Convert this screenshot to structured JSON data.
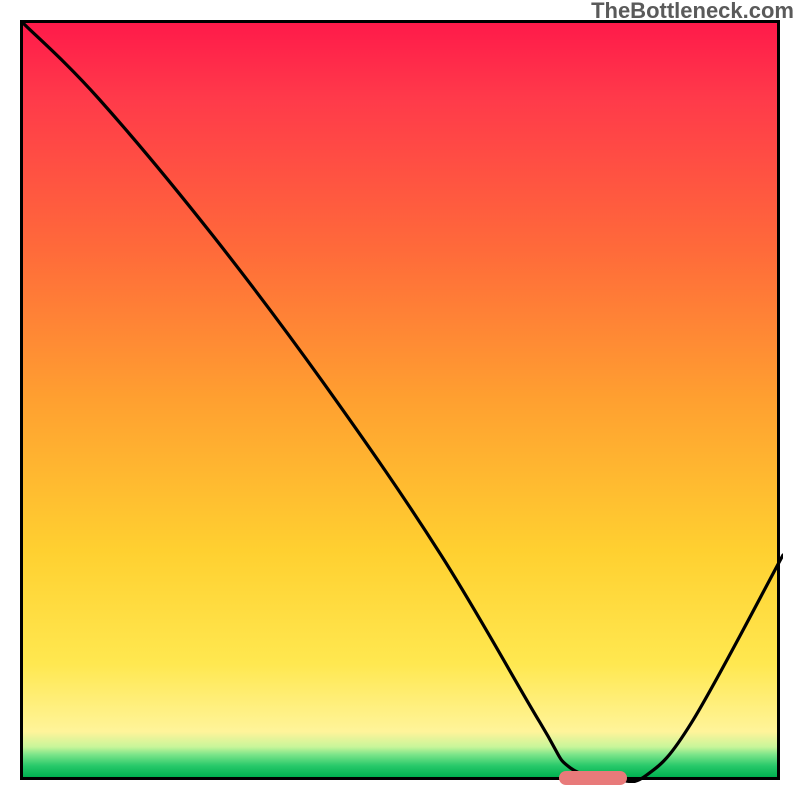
{
  "watermark": "TheBottleneck.com",
  "chart_data": {
    "type": "line",
    "title": "",
    "xlabel": "",
    "ylabel": "",
    "xlim": [
      0,
      100
    ],
    "ylim": [
      0,
      100
    ],
    "series": [
      {
        "name": "curve",
        "x": [
          0,
          10,
          25,
          40,
          55,
          68,
          72,
          78,
          82,
          88,
          100
        ],
        "y": [
          100,
          90,
          72,
          52,
          30,
          8,
          2,
          0.5,
          1,
          8,
          30
        ]
      }
    ],
    "marker": {
      "x_center": 75,
      "width": 9,
      "y": 0.7
    }
  }
}
